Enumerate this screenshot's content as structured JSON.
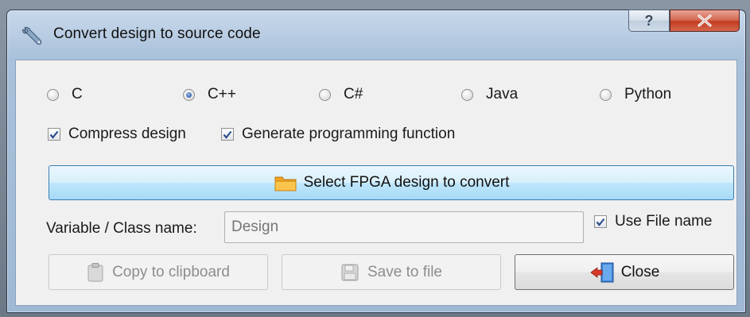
{
  "window": {
    "title": "Convert design to source code",
    "help_glyph": "?",
    "close_glyph": "X"
  },
  "languages": [
    {
      "label": "C",
      "selected": false
    },
    {
      "label": "C++",
      "selected": true
    },
    {
      "label": "C#",
      "selected": false
    },
    {
      "label": "Java",
      "selected": false
    },
    {
      "label": "Python",
      "selected": false
    }
  ],
  "options": {
    "compress_label": "Compress design",
    "compress_checked": true,
    "genfunc_label": "Generate programming function",
    "genfunc_checked": true
  },
  "select_button": {
    "label": "Select FPGA design to convert",
    "icon": "folder-icon"
  },
  "variable": {
    "label": "Variable / Class name:",
    "placeholder": "Design",
    "value": "",
    "use_file_label": "Use File name",
    "use_file_checked": true
  },
  "buttons": {
    "copy_label": "Copy to clipboard",
    "save_label": "Save to file",
    "close_label": "Close"
  },
  "colors": {
    "accent": "#3a64b0",
    "titlebar": "#b9cde3",
    "close_red": "#c33c21"
  }
}
